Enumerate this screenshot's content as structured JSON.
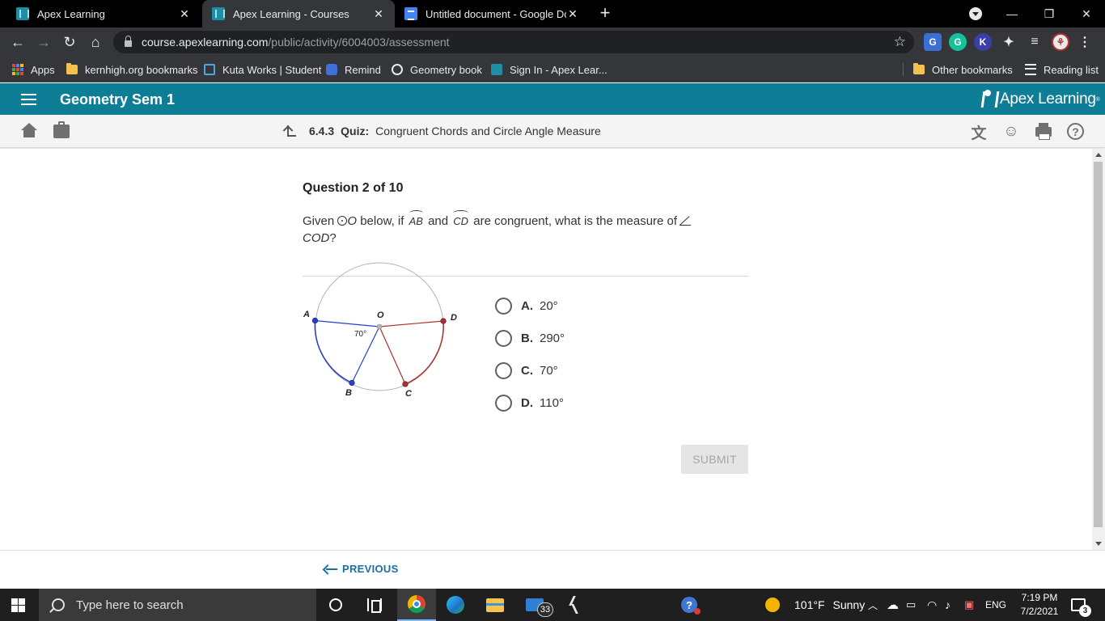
{
  "browser": {
    "tabs": [
      {
        "title": "Apex Learning",
        "active": false
      },
      {
        "title": "Apex Learning - Courses",
        "active": true
      },
      {
        "title": "Untitled document - Google Doc",
        "active": false
      }
    ],
    "new_tab_label": "+",
    "url_host": "course.apexlearning.com",
    "url_path": "/public/activity/6004003/assessment",
    "bookmarks": [
      "Apps",
      "kernhigh.org bookmarks",
      "Kuta Works | Student",
      "Remind",
      "Geometry book",
      "Sign In - Apex Lear..."
    ],
    "other_bookmarks": "Other bookmarks",
    "reading_list": "Reading list"
  },
  "apex": {
    "course_title": "Geometry Sem 1",
    "logo_text": "Apex Learning",
    "logo_mark": "®",
    "activity_number": "6.4.3",
    "activity_type": "Quiz:",
    "activity_title": "Congruent Chords and Circle Angle Measure",
    "help_label": "?"
  },
  "question": {
    "header": "Question 2 of 10",
    "text_given": "Given",
    "text_circle": "O",
    "text_below": "below, if",
    "arc1": "AB",
    "text_and": "and",
    "arc2": "CD",
    "text_rest": "are congruent, what is the measure of",
    "angle_name": "COD",
    "qmark": "?",
    "diagram": {
      "labels": {
        "A": "A",
        "O": "O",
        "D": "D",
        "B": "B",
        "C": "C"
      },
      "angle_label": "70°"
    },
    "choices": [
      {
        "letter": "A.",
        "text": "20°"
      },
      {
        "letter": "B.",
        "text": "290°"
      },
      {
        "letter": "C.",
        "text": "70°"
      },
      {
        "letter": "D.",
        "text": "110°"
      }
    ],
    "submit_label": "SUBMIT"
  },
  "footer": {
    "previous_label": "PREVIOUS"
  },
  "taskbar": {
    "search_placeholder": "Type here to search",
    "mail_badge": "33",
    "weather_temp": "101°F",
    "weather_cond": "Sunny",
    "language": "ENG",
    "time": "7:19 PM",
    "date": "7/2/2021",
    "notification_count": "3"
  },
  "colors": {
    "apex_teal": "#0e7e96",
    "chord_blue": "#2a3fc9",
    "chord_red": "#a83232",
    "link_blue": "#1a6ea8"
  }
}
